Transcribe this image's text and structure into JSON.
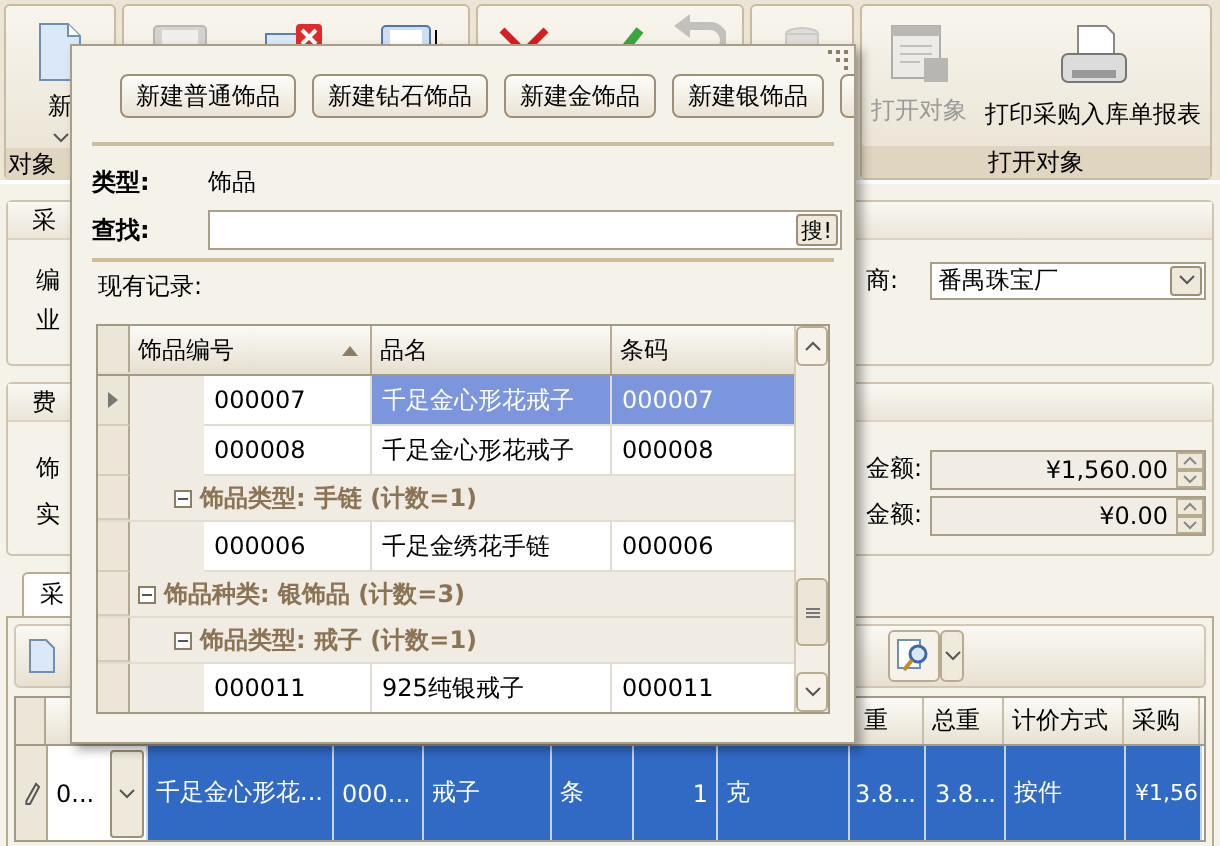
{
  "ribbon": {
    "groups": [
      {
        "label": "对象",
        "buttons": [
          {
            "kind": "document",
            "label": "新",
            "dropdown": true,
            "disabled": false
          }
        ]
      },
      {
        "buttons": [
          {
            "kind": "save",
            "disabled": true
          },
          {
            "kind": "delete",
            "disabled": false
          },
          {
            "kind": "saveas",
            "disabled": false
          }
        ]
      },
      {
        "buttons": [
          {
            "kind": "cross",
            "disabled": false
          },
          {
            "kind": "check",
            "disabled": false
          },
          {
            "kind": "undo",
            "disabled": true
          }
        ]
      },
      {
        "buttons": [
          {
            "kind": "database",
            "disabled": true
          }
        ]
      },
      {
        "label": "打开对象",
        "buttons": [
          {
            "kind": "form",
            "label": "打开对象",
            "disabled": true
          },
          {
            "kind": "printer",
            "label": "打印采购入库单报表",
            "disabled": false
          }
        ]
      }
    ]
  },
  "form": {
    "group_1": {
      "title": "采",
      "rows": [
        "编",
        "业"
      ],
      "supplier": {
        "label": "商:",
        "value": "番禺珠宝厂"
      }
    },
    "group_2": {
      "title": "费",
      "rows": [
        "饰",
        "实"
      ],
      "amounts": [
        {
          "label": "金额:",
          "value": "¥1,560.00"
        },
        {
          "label": "金额:",
          "value": "¥0.00"
        }
      ]
    }
  },
  "detail_tab": {
    "label": "采"
  },
  "detail_grid": {
    "headers": [
      "重",
      "总重",
      "计价方式",
      "采购"
    ],
    "rows": [
      {
        "editing": true,
        "selected": true,
        "cells": [
          "0...",
          "千足金心形花...",
          "000...",
          "戒子",
          "条",
          "1",
          "克",
          "3.8...",
          "3.8...",
          "按件",
          "¥1,56"
        ]
      }
    ]
  },
  "popup": {
    "buttons": [
      "新建普通饰品",
      "新建钻石饰品",
      "新建金饰品",
      "新建银饰品"
    ],
    "type": {
      "label": "类型:",
      "value": "饰品"
    },
    "search": {
      "label": "查找:",
      "button": "搜!"
    },
    "records_label": "现有记录:",
    "grid": {
      "columns": [
        {
          "label": "饰品编号",
          "sort_ascending": true
        },
        {
          "label": "品名"
        },
        {
          "label": "条码"
        }
      ],
      "rows": [
        {
          "kind": "group_body",
          "children": [
            {
              "kind": "group_body",
              "children": [
                {
                  "kind": "record",
                  "selected": true,
                  "cells": [
                    "000007",
                    "千足金心形花戒子",
                    "000007"
                  ]
                },
                {
                  "kind": "record",
                  "selected": false,
                  "cells": [
                    "000008",
                    "千足金心形花戒子",
                    "000008"
                  ]
                }
              ]
            },
            {
              "kind": "group",
              "label": "饰品类型: 手链 (计数=1)",
              "expanded": true,
              "children": [
                {
                  "kind": "record",
                  "selected": false,
                  "cells": [
                    "000006",
                    "千足金绣花手链",
                    "000006"
                  ]
                }
              ]
            }
          ]
        },
        {
          "kind": "group",
          "label": "饰品种类: 银饰品 (计数=3)",
          "expanded": true,
          "children": [
            {
              "kind": "group",
              "label": "饰品类型: 戒子 (计数=1)",
              "expanded": true,
              "children": [
                {
                  "kind": "record",
                  "selected": false,
                  "cells": [
                    "000011",
                    "925纯银戒子",
                    "000011"
                  ]
                }
              ]
            }
          ]
        }
      ]
    }
  }
}
